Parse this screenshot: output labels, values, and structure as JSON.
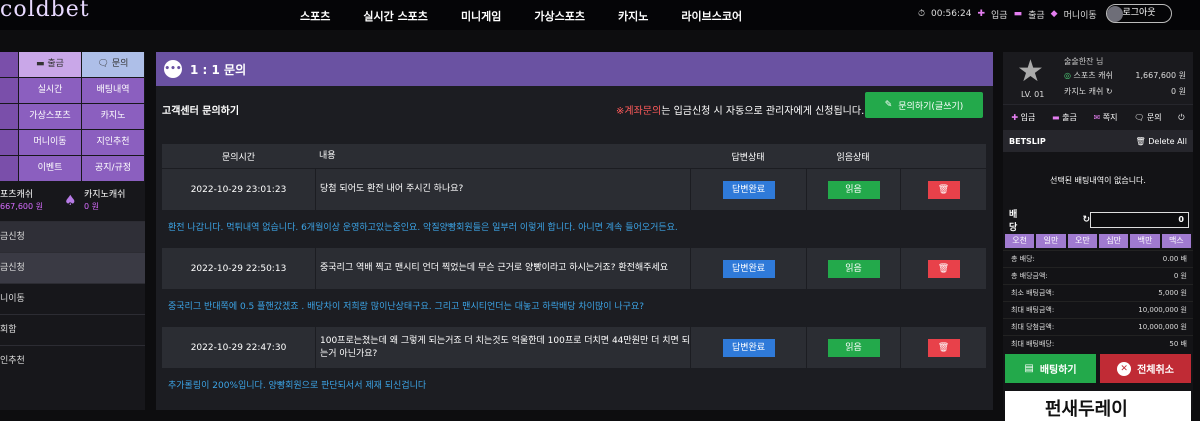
{
  "logo": "coldbet",
  "nav": [
    "스포츠",
    "실시간 스포츠",
    "미니게임",
    "가상스포츠",
    "카지노",
    "라이브스코어"
  ],
  "topright": {
    "time": "00:56:24",
    "deposit": "입금",
    "withdraw": "출금",
    "money_move": "머니이동",
    "logout": "로그아웃"
  },
  "left": {
    "grid": [
      [
        "",
        "출금",
        "문의"
      ],
      [
        "",
        "실시간",
        "배팅내역"
      ],
      [
        "",
        "가상스포츠",
        "카지노"
      ],
      [
        "",
        "머니이동",
        "지인추천"
      ],
      [
        "",
        "이벤트",
        "공지/규정"
      ]
    ],
    "grid_stubs": [
      "",
      "",
      "",
      "",
      ""
    ],
    "wallet_sports_label": "포츠캐쉬",
    "wallet_sports_value": "667,600 원",
    "wallet_casino_label": "카지노캐쉬",
    "wallet_casino_value": "0 원",
    "rows": [
      "금신청",
      "금신청",
      "니이동",
      "회함",
      "인추천"
    ]
  },
  "main": {
    "header": "1 : 1 문의",
    "subtitle": "고객센터 문의하기",
    "notice_red": "※계좌문의",
    "notice_rest": "는 입금신청 시 자동으로 관리자에게 신청됩니다.",
    "write_button": "문의하기(글쓰기)",
    "columns": [
      "문의시간",
      "내용",
      "답변상태",
      "읽음상태"
    ],
    "rows": [
      {
        "time": "2022-10-29 23:01:23",
        "content": "당첨 되어도 환전 내어 주시긴 하나요?",
        "status": "답변완료",
        "read": "읽음",
        "delete": "🗑",
        "answer": "환전 나갑니다. 먹튀내역 없습니다. 6개월이상 운영하고있는중인요. 악질양빵회원들은 일부러 이렇게 합니다. 아니면 계속 들어오거든요."
      },
      {
        "time": "2022-10-29 22:50:13",
        "content": "중국리그 역배 찍고 맨시티 언더 찍었는데 무슨 근거로 양빵이라고 하시는거죠? 환전해주세요",
        "status": "답변완료",
        "read": "읽음",
        "delete": "🗑",
        "answer": "중국리그 반대쪽에 0.5 플핸갔겠죠 . 배당차이 저희랑 많이난상태구요. 그리고 맨시티언더는 대놓고 하락배당 차이많이 나구요?"
      },
      {
        "time": "2022-10-29 22:47:30",
        "content": "100프로는쳤는데 왜 그렇게 되는거죠 더 치는것도 억울한데 100프로 더치면 44만원만 더 치면 되는거 아닌가요?",
        "status": "답변완료",
        "read": "읽음",
        "delete": "🗑",
        "answer": "추가롤링이 200%입니다. 양빵회원으로 판단되서서 제재 되신겁니다"
      }
    ]
  },
  "right": {
    "user": "술술한잔 님",
    "level": "LV. 01",
    "sports_cash_label": "스포츠 캐쉬",
    "sports_cash": "1,667,600 원",
    "casino_cash_label": "카지노 캐쉬",
    "casino_cash": "0 원",
    "buttons": [
      "입금",
      "출금",
      "쪽지",
      "문의"
    ],
    "betslip": "BETSLIP",
    "delete_all": "Delete All",
    "empty_text": "선택된 배팅내역이 없습니다.",
    "bet_label": "배당",
    "bet_value": "0",
    "chips": [
      "오천",
      "일만",
      "오만",
      "십만",
      "백만",
      "맥스"
    ],
    "info": [
      [
        "총 배당:",
        "0.00 배"
      ],
      [
        "총 배당금액:",
        "0 원"
      ],
      [
        "최소 배팅금액:",
        "5,000 원"
      ],
      [
        "최대 배팅금액:",
        "10,000,000 원"
      ],
      [
        "최대 당첨금액:",
        "10,000,000 원"
      ],
      [
        "최대 배팅배당:",
        "50 배"
      ]
    ],
    "bet_button": "배팅하기",
    "cancel_button": "전체취소",
    "banner": "펀새두레이"
  }
}
